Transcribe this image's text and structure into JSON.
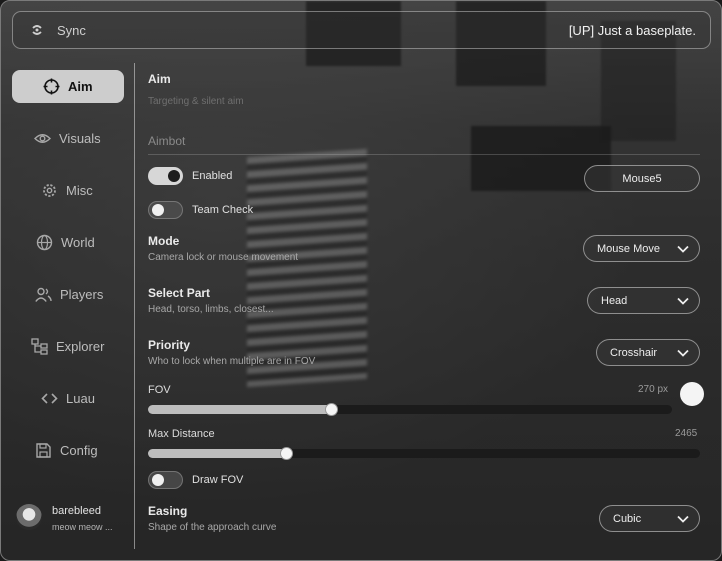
{
  "header": {
    "title": "Sync",
    "place": "[UP] Just a baseplate."
  },
  "sidebar": {
    "items": [
      {
        "label": "Aim",
        "icon": "crosshair-icon",
        "active": true
      },
      {
        "label": "Visuals",
        "icon": "eye-icon"
      },
      {
        "label": "Misc",
        "icon": "gear-icon"
      },
      {
        "label": "World",
        "icon": "globe-icon"
      },
      {
        "label": "Players",
        "icon": "users-icon"
      },
      {
        "label": "Explorer",
        "icon": "tree-icon"
      },
      {
        "label": "Luau",
        "icon": "code-icon"
      },
      {
        "label": "Config",
        "icon": "save-icon"
      }
    ],
    "user": {
      "name": "barebleed",
      "status": "meow meow ..."
    }
  },
  "content": {
    "title": "Aim",
    "subtitle": "Targeting & silent aim",
    "section": "Aimbot",
    "enabled": {
      "label": "Enabled",
      "on": true,
      "keybind": "Mouse5"
    },
    "team_check": {
      "label": "Team Check",
      "on": false
    },
    "mode": {
      "title": "Mode",
      "desc": "Camera lock or mouse movement",
      "value": "Mouse Move"
    },
    "select_part": {
      "title": "Select Part",
      "desc": "Head, torso, limbs, closest...",
      "value": "Head"
    },
    "priority": {
      "title": "Priority",
      "desc": "Who to lock when multiple are in FOV",
      "value": "Crosshair"
    },
    "fov": {
      "label": "FOV",
      "value": "270 px",
      "fraction": 0.35
    },
    "max_distance": {
      "label": "Max Distance",
      "value": "2465",
      "fraction": 0.25
    },
    "draw_fov": {
      "label": "Draw FOV",
      "on": false
    },
    "easing": {
      "title": "Easing",
      "desc": "Shape of the approach curve",
      "value": "Cubic"
    }
  },
  "colors": {
    "accent": "#d7d7d7",
    "active_bg": "#e1e1e1"
  }
}
